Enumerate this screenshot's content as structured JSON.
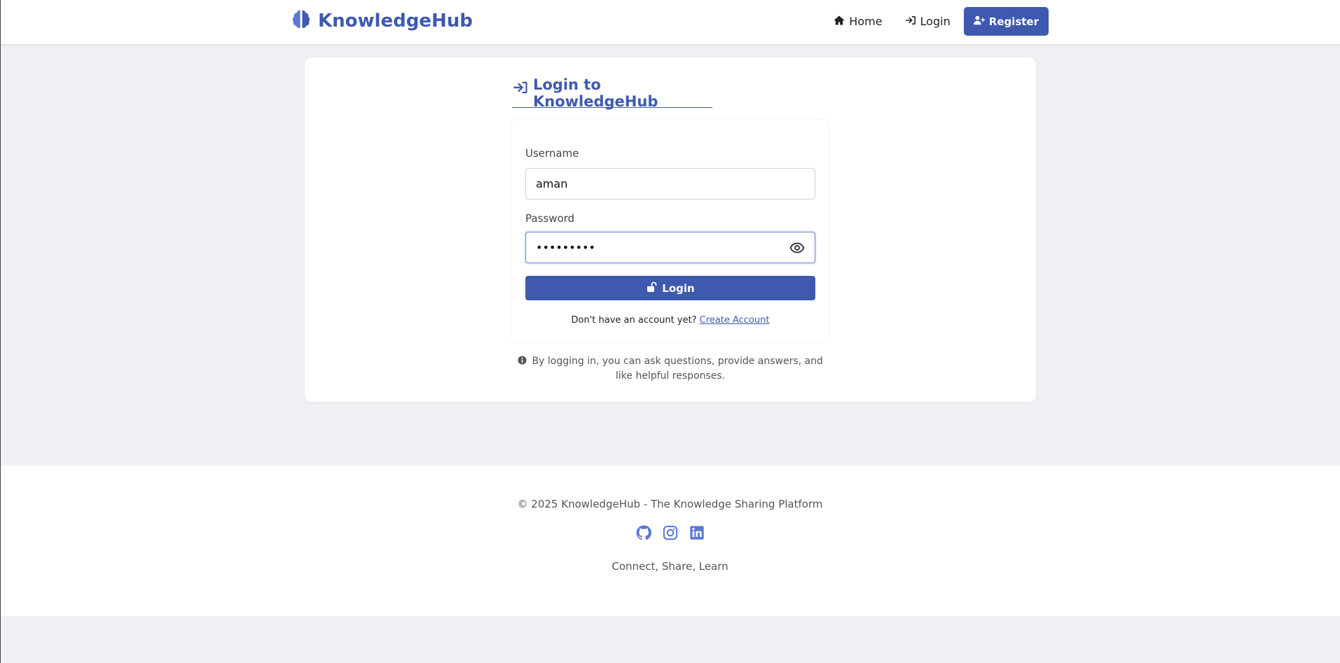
{
  "brand": {
    "name": "KnowledgeHub",
    "icon": "brain-icon"
  },
  "nav": {
    "home": {
      "label": "Home",
      "icon": "home-icon"
    },
    "login": {
      "label": "Login",
      "icon": "sign-in-icon"
    },
    "register": {
      "label": "Register",
      "icon": "user-plus-icon"
    }
  },
  "login_form": {
    "title": "Login to KnowledgeHub",
    "title_icon": "sign-in-icon",
    "username_label": "Username",
    "username_value": "aman",
    "password_label": "Password",
    "password_value": "•••••••••",
    "password_toggle_icon": "eye-icon",
    "submit_label": "Login",
    "submit_icon": "unlock-icon",
    "signup_prompt": "Don't have an account yet?",
    "signup_link": "Create Account",
    "info_icon": "info-circle-icon",
    "info_text": "By logging in, you can ask questions, provide answers, and like helpful responses."
  },
  "footer": {
    "copyright": "© 2025 KnowledgeHub - The Knowledge Sharing Platform",
    "socials": [
      "github-icon",
      "instagram-icon",
      "linkedin-icon"
    ],
    "tagline": "Connect, Share, Learn"
  },
  "colors": {
    "primary": "#3f59ae",
    "background": "#eff0f4",
    "focus_border": "#6e84d8"
  }
}
